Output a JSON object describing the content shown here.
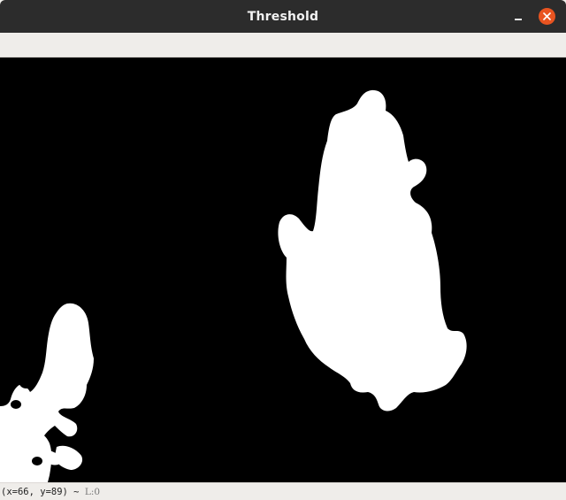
{
  "window": {
    "title": "Threshold",
    "controls": {
      "minimize_icon": "minimize-icon",
      "close_icon": "close-icon",
      "close_color": "#e95420"
    }
  },
  "image": {
    "description_colors": {
      "background": "#000000",
      "foreground": "#ffffff"
    }
  },
  "statusbar": {
    "coords": "(x=66, y=89) ~",
    "value": "L:0"
  }
}
